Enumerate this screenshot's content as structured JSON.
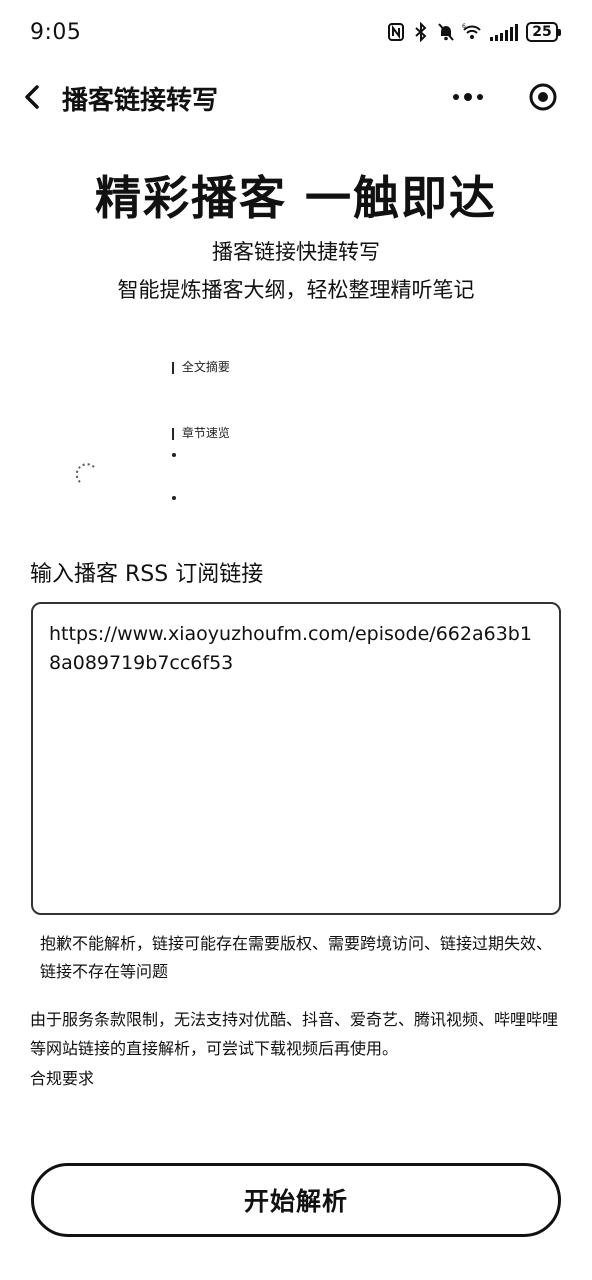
{
  "status_bar": {
    "time": "9:05",
    "battery": "25",
    "icons": [
      "nfc-icon",
      "bluetooth-icon",
      "mute-bell-icon",
      "wifi-icon",
      "signal-icon",
      "battery-icon"
    ]
  },
  "nav": {
    "title": "播客链接转写",
    "back_icon": "chevron-left-icon",
    "more_icon": "more-dots-icon",
    "target_icon": "target-icon"
  },
  "hero": {
    "title": "精彩播客 一触即达",
    "subtitle_1": "播客链接快捷转写",
    "subtitle_2": "智能提炼播客大纲，轻松整理精听笔记"
  },
  "preview": {
    "heading_1": "全文摘要",
    "heading_2": "章节速览"
  },
  "input": {
    "label": "输入播客 RSS 订阅链接",
    "value": "https://www.xiaoyuzhoufm.com/episode/662a63b18a089719b7cc6f53"
  },
  "error_message": "抱歉不能解析，链接可能存在需要版权、需要跨境访问、链接过期失效、链接不存在等问题",
  "notice": "由于服务条款限制，无法支持对优酷、抖音、爱奇艺、腾讯视频、哔哩哔哩等网站链接的直接解析，可尝试下载视频后再使用。",
  "compliance_link": "合规要求",
  "start_button": "开始解析",
  "colors": {
    "text": "#111111",
    "background": "#ffffff",
    "border": "#333333"
  }
}
